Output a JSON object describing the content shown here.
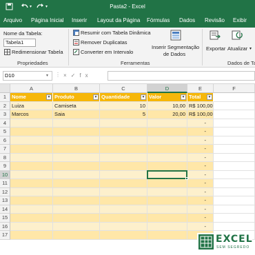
{
  "app": {
    "doc_title": "Pasta2  -  Excel",
    "save_icon": "save-icon",
    "undo_icon": "undo-icon",
    "redo_icon": "redo-icon"
  },
  "tabs": [
    "Arquivo",
    "Página Inicial",
    "Inserir",
    "Layout da Página",
    "Fórmulas",
    "Dados",
    "Revisão",
    "Exibir"
  ],
  "ribbon": {
    "properties": {
      "name_label": "Nome da Tabela:",
      "name_value": "Tabela1",
      "resize_label": "Redimensionar Tabela",
      "group_label": "Propriedades"
    },
    "tools": {
      "summarize_label": "Resumir com Tabela Dinâmica",
      "remove_dup_label": "Remover Duplicatas",
      "convert_label": "Converter em Intervalo",
      "slicer_label_1": "Inserir Segmentação",
      "slicer_label_2": "de Dados",
      "group_label": "Ferramentas"
    },
    "external": {
      "export_label": "Exportar",
      "refresh_label": "Atualizar",
      "group_label": "Dados de Ta"
    }
  },
  "formula_bar": {
    "name_box": "D10",
    "fx": "×✓fx",
    "formula": ""
  },
  "grid": {
    "columns": [
      "A",
      "B",
      "C",
      "D",
      "E",
      "F"
    ],
    "active_column": "D",
    "active_row": "10",
    "rows": [
      "1",
      "2",
      "3",
      "4",
      "5",
      "6",
      "7",
      "8",
      "9",
      "10",
      "11",
      "12",
      "13",
      "14",
      "15",
      "16",
      "17"
    ],
    "table_headers": [
      "Nome",
      "Produto",
      "Quantidade",
      "Valor",
      "Total"
    ],
    "table_rows": [
      [
        "Luiza",
        "Camiseta",
        "10",
        "10,00",
        "R$ 100,00"
      ],
      [
        "Marcos",
        "Saia",
        "5",
        "20,00",
        "R$ 100,00"
      ]
    ],
    "empty_total": "-"
  },
  "logo": {
    "text": "EXCEL",
    "subtitle": "SEM SEGREDO",
    "brand_color": "#217346"
  },
  "colors": {
    "accent": "#217346",
    "table_header": "#f6b70a",
    "band_light": "#fdf0cc",
    "band_dark": "#ffe7a8"
  }
}
